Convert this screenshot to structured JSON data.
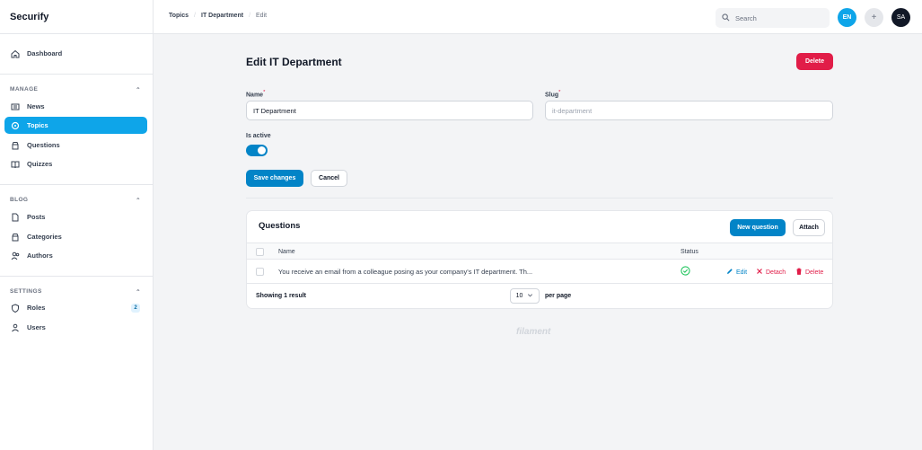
{
  "app": {
    "name": "Securify"
  },
  "sidebar": {
    "dashboard": "Dashboard",
    "groups": {
      "manage": "MANAGE",
      "blog": "BLOG",
      "settings": "SETTINGS"
    },
    "items": {
      "news": "News",
      "topics": "Topics",
      "questions": "Questions",
      "quizzes": "Quizzes",
      "posts": "Posts",
      "categories": "Categories",
      "authors": "Authors",
      "roles": "Roles",
      "roles_badge": "2",
      "users": "Users"
    }
  },
  "header": {
    "breadcrumbs": [
      "Topics",
      "IT Department",
      "Edit"
    ],
    "search_placeholder": "Search",
    "locale": "EN",
    "add": "+",
    "avatar": "SA"
  },
  "form": {
    "title": "Edit IT Department",
    "delete_label": "Delete",
    "name_label": "Name",
    "name_value": "IT Department",
    "slug_label": "Slug",
    "slug_value": "it-department",
    "required_mark": "*",
    "active_label": "Is active",
    "is_active": true,
    "save_label": "Save changes",
    "cancel_label": "Cancel"
  },
  "questions": {
    "title": "Questions",
    "new_label": "New question",
    "attach_label": "Attach",
    "columns": {
      "name": "Name",
      "status": "Status"
    },
    "rows": [
      {
        "name": "You receive an email from a colleague posing as your company's IT department. Th...",
        "status_icon": "check-circle-icon"
      }
    ],
    "actions": {
      "edit": "Edit",
      "detach": "Detach",
      "delete": "Delete"
    },
    "summary": "Showing 1 result",
    "per_page_value": "10",
    "per_page_label": "per page"
  },
  "footer": {
    "brand": "filament"
  },
  "colors": {
    "primary": "#0284c7",
    "sky": "#0ea5e9",
    "danger": "#e11d48",
    "success": "#22c55e"
  }
}
